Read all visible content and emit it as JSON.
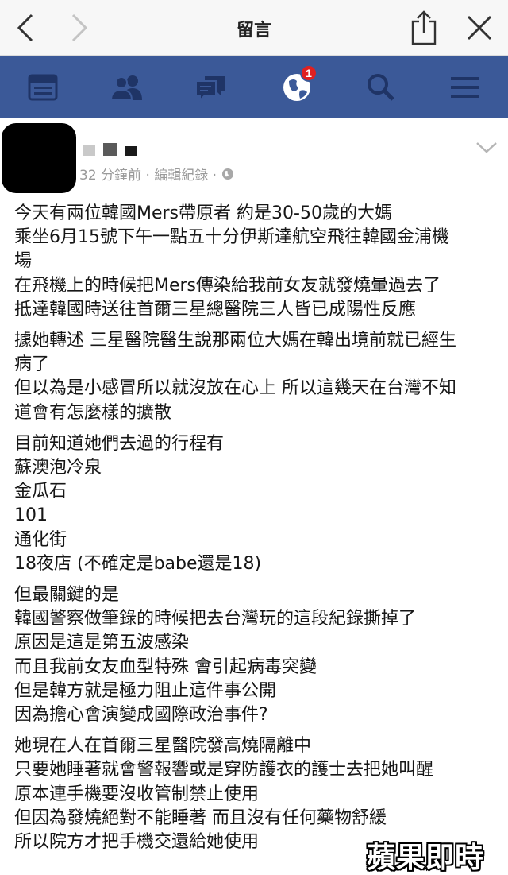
{
  "topbar": {
    "title": "留言"
  },
  "fbbar": {
    "tabs": [
      {
        "icon": "news-feed-icon"
      },
      {
        "icon": "friends-icon"
      },
      {
        "icon": "messages-icon"
      },
      {
        "icon": "globe-notifications-icon",
        "badge": "1"
      },
      {
        "icon": "search-icon"
      },
      {
        "icon": "menu-icon"
      }
    ]
  },
  "post": {
    "meta": "32 分鐘前 · 編輯紀錄 ·",
    "paragraphs": [
      [
        "今天有兩位韓國Mers帶原者 約是30-50歲的大媽",
        "乘坐6月15號下午一點五十分伊斯達航空飛往韓國金浦機",
        "場",
        "在飛機上的時候把Mers傳染給我前女友就發燒暈過去了",
        "抵達韓國時送往首爾三星總醫院三人皆已成陽性反應"
      ],
      [
        "據她轉述 三星醫院醫生說那兩位大媽在韓出境前就已經生",
        "病了",
        "但以為是小感冒所以就沒放在心上 所以這幾天在台灣不知",
        "道會有怎麼樣的擴散"
      ],
      [
        "目前知道她們去過的行程有",
        "蘇澳泡冷泉",
        "金瓜石",
        "101",
        "通化街",
        "18夜店 (不確定是babe還是18)"
      ],
      [
        "但最關鍵的是",
        "韓國警察做筆錄的時候把去台灣玩的這段紀錄撕掉了",
        "原因是這是第五波感染",
        "而且我前女友血型特殊 會引起病毒突變",
        "但是韓方就是極力阻止這件事公開",
        "因為擔心會演變成國際政治事件?"
      ],
      [
        "她現在人在首爾三星醫院發高燒隔離中",
        "只要她睡著就會警報響或是穿防護衣的護士去把她叫醒",
        "原本連手機要沒收管制禁止使用",
        "但因為發燒絕對不能睡著 而且沒有任何藥物舒緩",
        "所以院方才把手機交還給她使用"
      ]
    ]
  },
  "watermark": "蘋果即時",
  "colors": {
    "fb_blue": "#3b5998",
    "badge_red": "#e02020"
  }
}
